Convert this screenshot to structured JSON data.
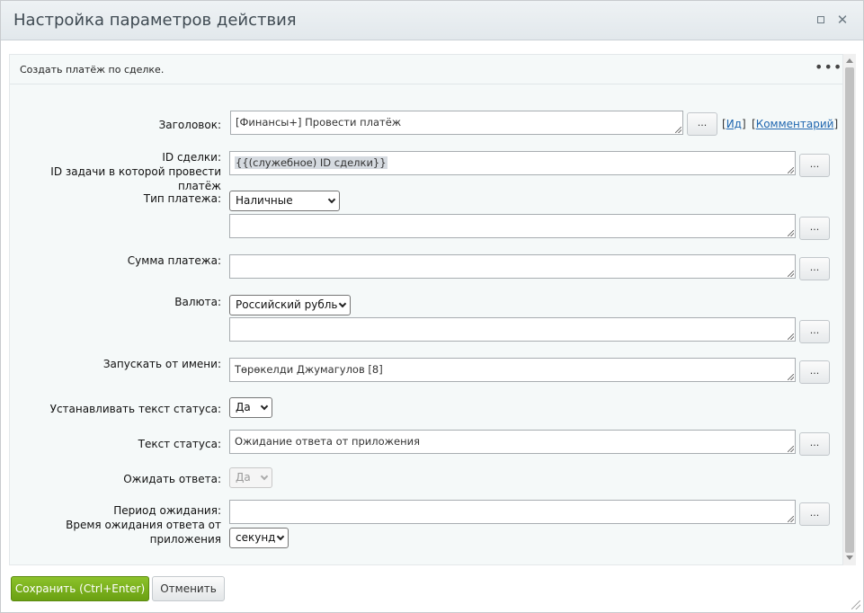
{
  "window": {
    "title": "Настройка параметров действия"
  },
  "section": {
    "title": "Создать платёж по сделке.",
    "more_label": "•••"
  },
  "fields": {
    "title": {
      "label": "Заголовок:",
      "value": "[Финансы+] Провести платёж"
    },
    "deal_id": {
      "label": "ID сделки:",
      "hint": "ID задачи в которой провести платёж",
      "value": "{{(служебное) ID сделки}}"
    },
    "payment_type": {
      "label": "Тип платежа:",
      "selected": "Наличные",
      "value": ""
    },
    "amount": {
      "label": "Сумма платежа:",
      "value": ""
    },
    "currency": {
      "label": "Валюта:",
      "selected": "Российский рубль",
      "value": ""
    },
    "run_as": {
      "label": "Запускать от имени:",
      "value": "Төрөкелди Джумагулов [8]"
    },
    "set_status_text": {
      "label": "Устанавливать текст статуса:",
      "selected": "Да"
    },
    "status_text": {
      "label": "Текст статуса:",
      "value": "Ожидание ответа от приложения"
    },
    "wait_answer": {
      "label": "Ожидать ответа:",
      "selected": "Да"
    },
    "wait_period": {
      "label": "Период ожидания:",
      "hint_line1": "Время ожидания ответа от",
      "hint_line2": "приложения",
      "value": "",
      "unit": "секунд"
    }
  },
  "links": {
    "id": "Ид",
    "comment": "Комментарий"
  },
  "dots_label": "...",
  "buttons": {
    "save": "Сохранить (Ctrl+Enter)",
    "cancel": "Отменить"
  }
}
